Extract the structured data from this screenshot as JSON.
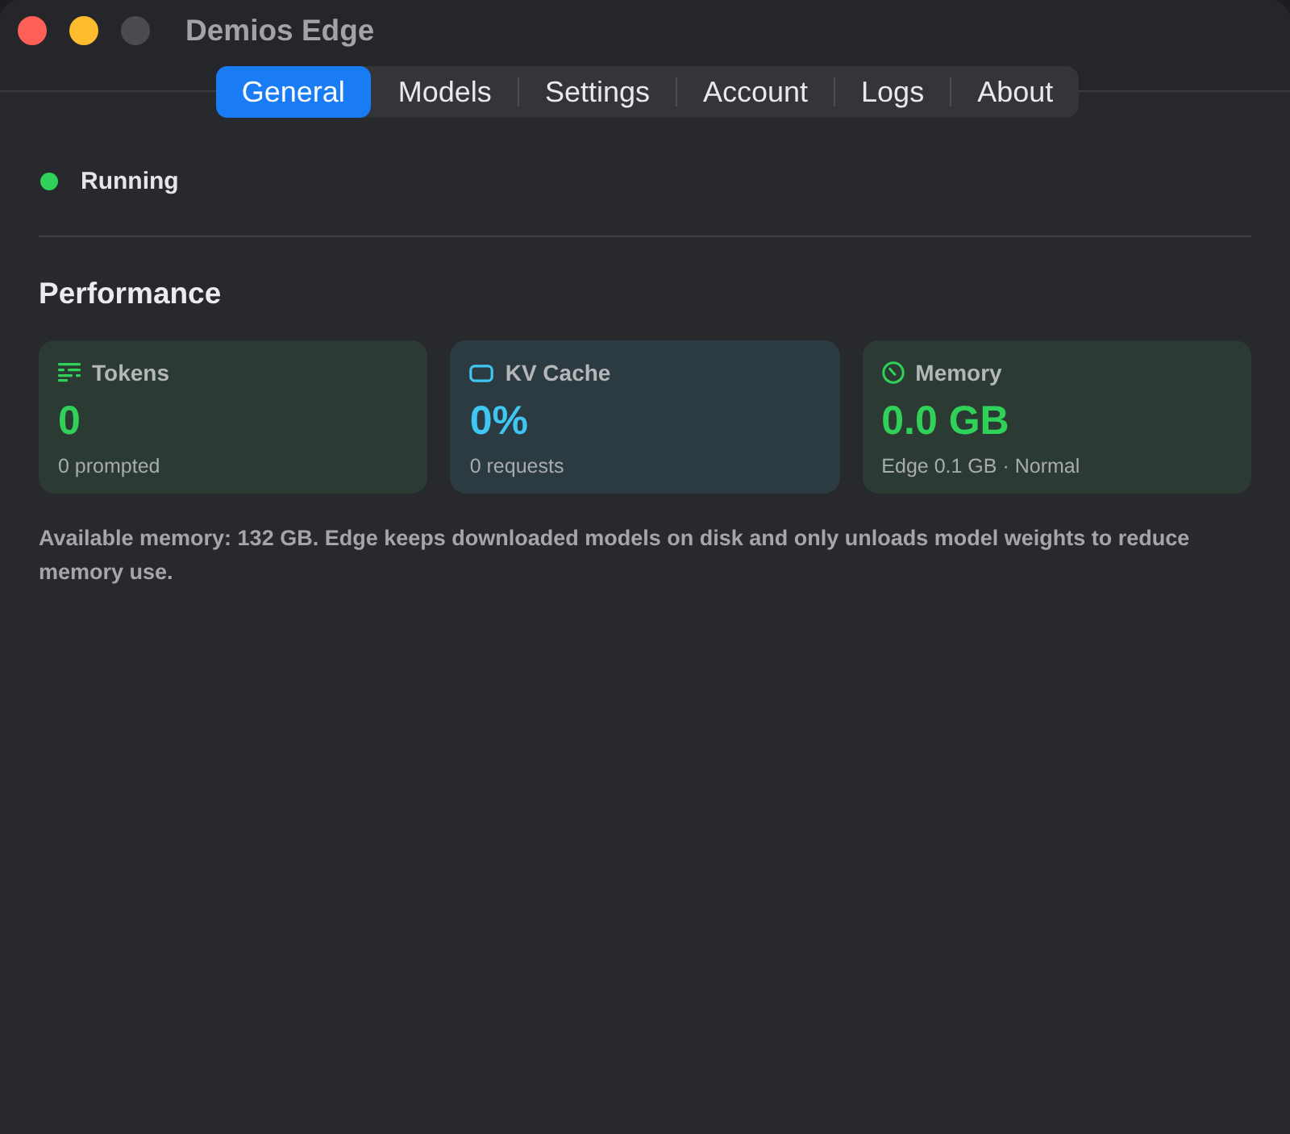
{
  "window": {
    "title": "Demios Edge"
  },
  "tabs": [
    {
      "label": "General",
      "selected": true
    },
    {
      "label": "Models",
      "selected": false
    },
    {
      "label": "Settings",
      "selected": false
    },
    {
      "label": "Account",
      "selected": false
    },
    {
      "label": "Logs",
      "selected": false
    },
    {
      "label": "About",
      "selected": false
    }
  ],
  "status": {
    "label": "Running",
    "running": true
  },
  "performance": {
    "title": "Performance",
    "cards": [
      {
        "kind": "tokens",
        "title": "Tokens",
        "value": "0",
        "detail": "0 prompted",
        "color": "#30d158"
      },
      {
        "kind": "cache",
        "title": "KV Cache",
        "value": "0%",
        "detail": "0 requests",
        "color": "#3fc6f2"
      },
      {
        "kind": "memory",
        "title": "Memory",
        "value": "0.0 GB",
        "detail": "Edge 0.1 GB · Normal",
        "color": "#30d158"
      }
    ],
    "note": "Available memory: 132 GB. Edge keeps downloaded models on disk and only unloads model weights to reduce memory use."
  }
}
